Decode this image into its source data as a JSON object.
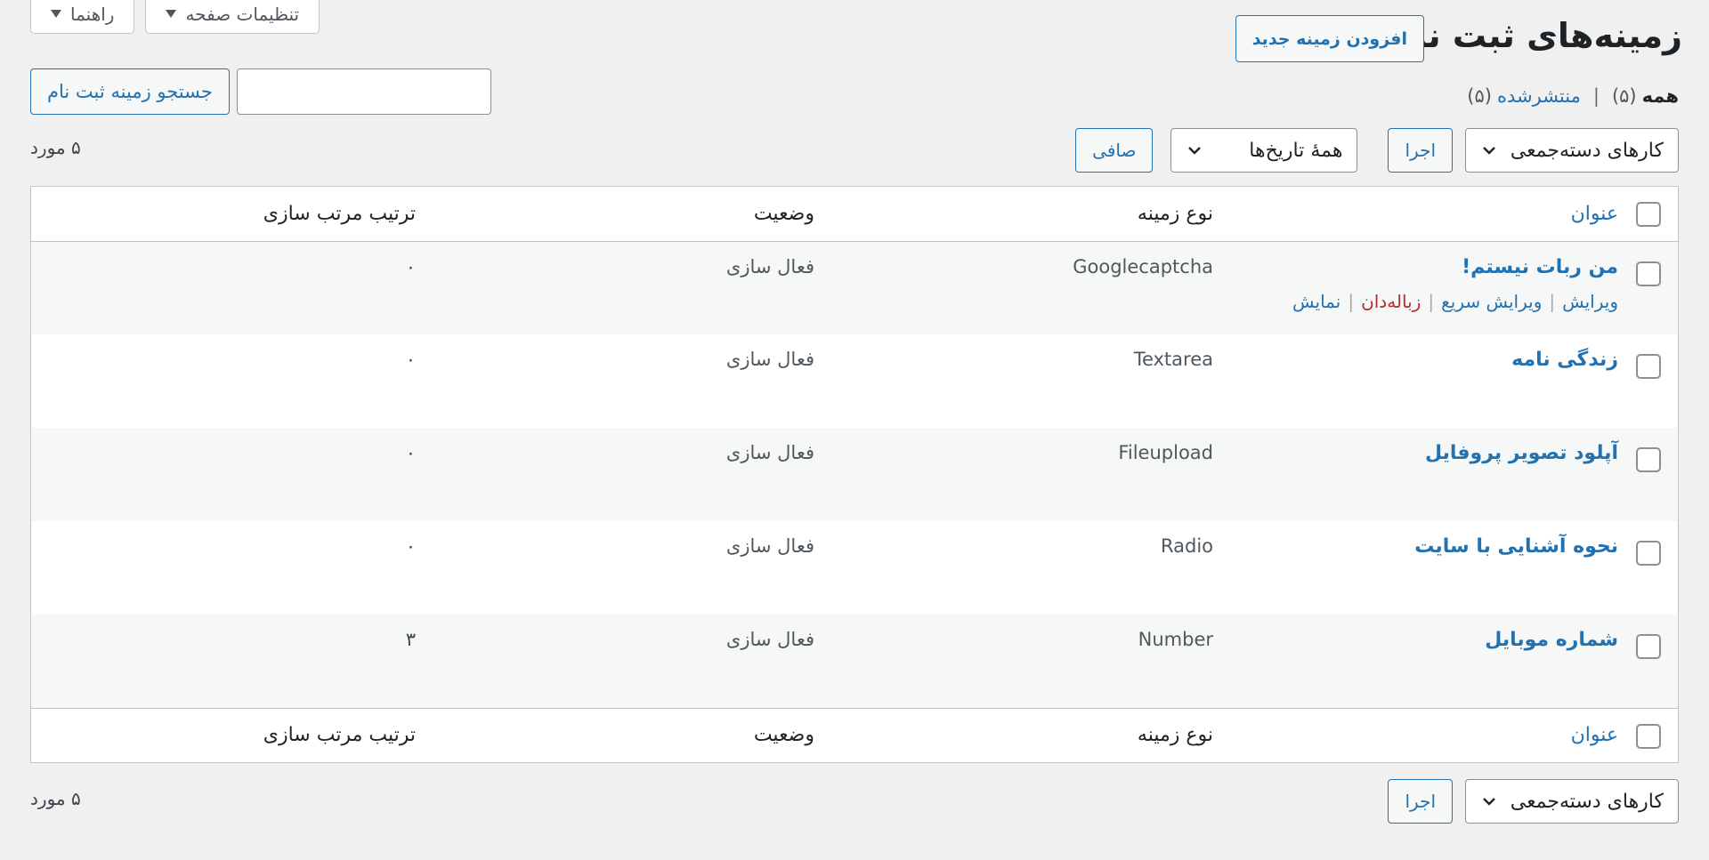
{
  "screen_meta": {
    "screen_options": "تنظیمات صفحه",
    "help": "راهنما"
  },
  "header": {
    "title": "زمینه‌های ثبت نام",
    "add_new": "افزودن زمینه جدید"
  },
  "views": {
    "all_label": "همه",
    "all_count": "(۵)",
    "separator": "|",
    "published_label": "منتشرشده",
    "published_count": "(۵)"
  },
  "search": {
    "placeholder": "",
    "button": "جستجو زمینه ثبت نام"
  },
  "tablenav_top": {
    "bulk_actions": "کارهای دسته‌جمعی",
    "apply": "اجرا",
    "dates": "همهٔ تاریخ‌ها",
    "filter": "صافی",
    "items_count": "۵ مورد"
  },
  "tablenav_bottom": {
    "bulk_actions": "کارهای دسته‌جمعی",
    "apply": "اجرا",
    "items_count": "۵ مورد"
  },
  "table": {
    "columns": {
      "title": "عنوان",
      "type": "نوع زمینه",
      "status": "وضعیت",
      "order": "ترتیب مرتب سازی"
    },
    "row_actions": {
      "edit": "ویرایش",
      "quick_edit": "ویرایش سریع",
      "trash": "زباله‌دان",
      "view": "نمایش",
      "sep": "|"
    },
    "rows": [
      {
        "title": "من ربات نیستم!",
        "type": "Googlecaptcha",
        "status": "فعال سازی",
        "order": "۰"
      },
      {
        "title": "زندگی نامه",
        "type": "Textarea",
        "status": "فعال سازی",
        "order": "۰"
      },
      {
        "title": "آپلود تصویر پروفایل",
        "type": "Fileupload",
        "status": "فعال سازی",
        "order": "۰"
      },
      {
        "title": "نحوه آشنایی با سایت",
        "type": "Radio",
        "status": "فعال سازی",
        "order": "۰"
      },
      {
        "title": "شماره موبایل",
        "type": "Number",
        "status": "فعال سازی",
        "order": "۳"
      }
    ]
  },
  "colors": {
    "link": "#2271b1",
    "trash": "#b32d2e",
    "background": "#f0f0f1"
  }
}
